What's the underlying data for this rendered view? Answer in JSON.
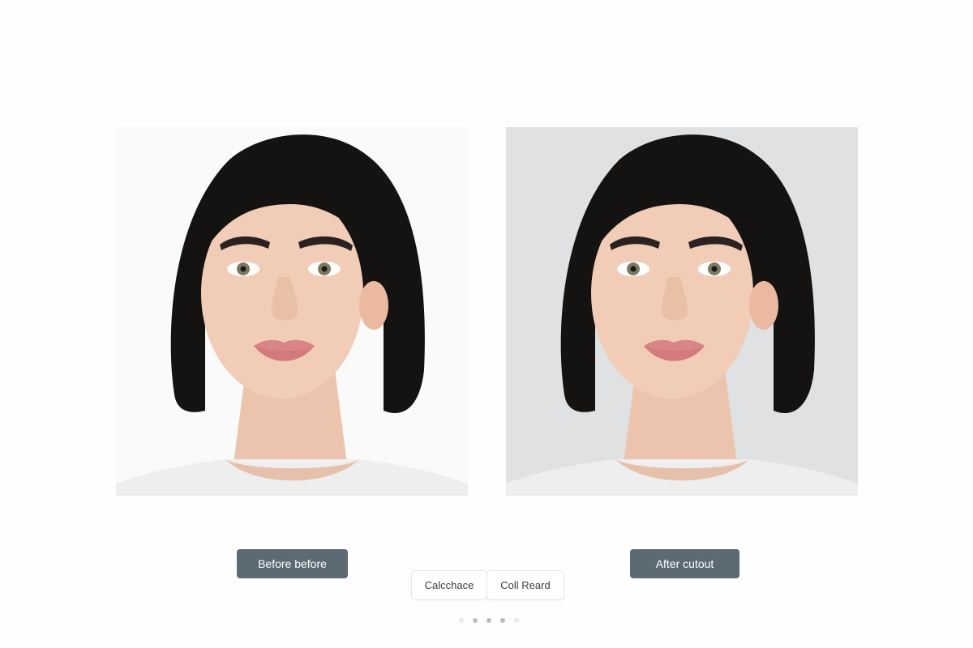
{
  "comparison": {
    "before_label": "Before before",
    "after_label": "After cutout"
  },
  "actions": {
    "left_label": "Calcchace",
    "right_label": "Coll Reard"
  },
  "pagination": {
    "count": 5,
    "active_indices": [
      1,
      2,
      3
    ]
  },
  "colors": {
    "label_bg": "#5c6a74",
    "before_bg": "#fafafa",
    "after_bg": "#dfe1e3",
    "hair": "#151312",
    "skin": "#f1cdb8",
    "lips": "#d98486",
    "shirt": "#eeeeee"
  }
}
